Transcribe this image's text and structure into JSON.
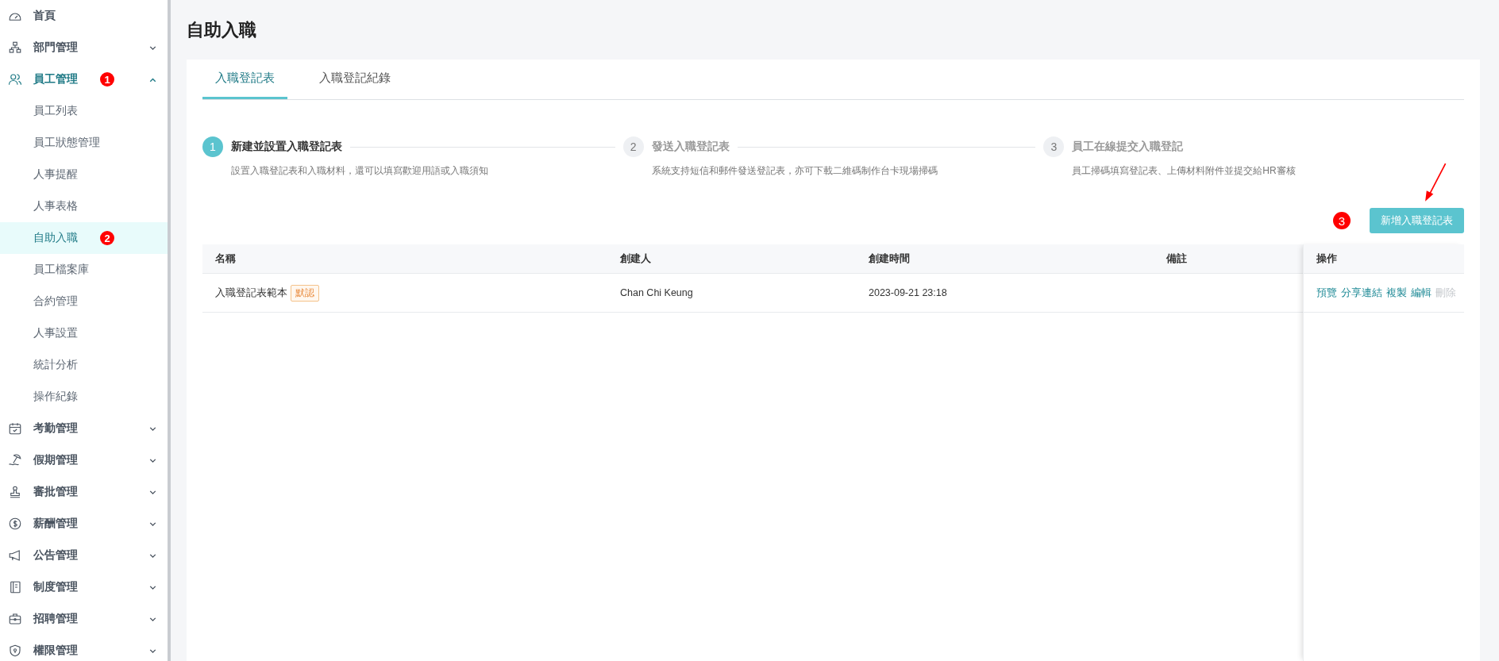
{
  "page_title": "自助入職",
  "sidebar": {
    "items": [
      {
        "label": "首頁",
        "kind": "link",
        "active": false
      },
      {
        "label": "部門管理",
        "kind": "group",
        "active": false,
        "expanded": false
      },
      {
        "label": "員工管理",
        "kind": "group",
        "active": true,
        "expanded": true,
        "marker": "1",
        "children": [
          {
            "label": "員工列表",
            "selected": false
          },
          {
            "label": "員工狀態管理",
            "selected": false
          },
          {
            "label": "人事提醒",
            "selected": false
          },
          {
            "label": "人事表格",
            "selected": false
          },
          {
            "label": "自助入職",
            "selected": true,
            "marker": "2"
          },
          {
            "label": "員工檔案庫",
            "selected": false
          },
          {
            "label": "合約管理",
            "selected": false
          },
          {
            "label": "人事設置",
            "selected": false
          },
          {
            "label": "統計分析",
            "selected": false
          },
          {
            "label": "操作紀錄",
            "selected": false
          }
        ]
      },
      {
        "label": "考勤管理",
        "kind": "group",
        "active": false,
        "expanded": false
      },
      {
        "label": "假期管理",
        "kind": "group",
        "active": false,
        "expanded": false
      },
      {
        "label": "審批管理",
        "kind": "group",
        "active": false,
        "expanded": false
      },
      {
        "label": "薪酬管理",
        "kind": "group",
        "active": false,
        "expanded": false
      },
      {
        "label": "公告管理",
        "kind": "group",
        "active": false,
        "expanded": false
      },
      {
        "label": "制度管理",
        "kind": "group",
        "active": false,
        "expanded": false
      },
      {
        "label": "招聘管理",
        "kind": "group",
        "active": false,
        "expanded": false
      },
      {
        "label": "權限管理",
        "kind": "group",
        "active": false,
        "expanded": false
      }
    ]
  },
  "tabs": [
    {
      "label": "入職登記表",
      "selected": true
    },
    {
      "label": "入職登記紀錄",
      "selected": false
    }
  ],
  "steps": [
    {
      "number": "1",
      "title": "新建並設置入職登記表",
      "description": "設置入職登記表和入職材料，還可以填寫歡迎用語或入職須知",
      "active": true
    },
    {
      "number": "2",
      "title": "發送入職登記表",
      "description": "系統支持短信和郵件發送登記表，亦可下載二維碼制作台卡現場掃碼",
      "active": false
    },
    {
      "number": "3",
      "title": "員工在線提交入職登記",
      "description": "員工掃碼填寫登記表、上傳材料附件並提交給HR審核",
      "active": false
    }
  ],
  "add_button": {
    "label": "新增入職登記表",
    "marker": "3"
  },
  "table": {
    "columns": [
      "名稱",
      "創建人",
      "創建時間",
      "備註",
      "操作"
    ],
    "rows": [
      {
        "name": "入職登記表範本",
        "tag": "默認",
        "creator": "Chan Chi Keung",
        "created": "2023-09-21 23:18",
        "actions": [
          {
            "label": "預覽",
            "disabled": false
          },
          {
            "label": "分享連結",
            "disabled": false
          },
          {
            "label": "複製",
            "disabled": false
          },
          {
            "label": "編輯",
            "disabled": false
          },
          {
            "label": "刪除",
            "disabled": true
          }
        ]
      }
    ]
  }
}
